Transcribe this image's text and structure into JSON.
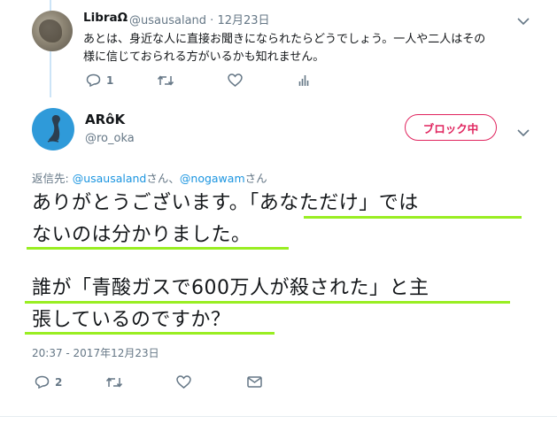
{
  "tweet1": {
    "display_name": "LibraΩ",
    "handle": "@usausaland",
    "separator": "·",
    "date": "12月23日",
    "text_line1": "あとは、身近な人に直接お聞きになられたらどうでしょう。一人や二人はその",
    "text_line2": "様に信じておられる方がいるかも知れません。",
    "reply_count": "1",
    "icons": [
      "reply-icon",
      "retweet-icon",
      "like-icon",
      "analytics-icon",
      "chevron-down-icon"
    ]
  },
  "tweet2": {
    "display_name": "ARôK",
    "handle": "@ro_oka",
    "block_button": "ブロック中",
    "reply_to_prefix": "返信先: ",
    "reply_to_user1": "@usausaland",
    "reply_to_sep": "さん、",
    "reply_to_user2": "@nogawam",
    "reply_to_suffix": "さん",
    "line1": "ありがとうございます。「あなただけ」では",
    "line2": "ないのは分かりました。",
    "line3": "誰が「青酸ガスで600万人が殺された」と主",
    "line4": "張しているのですか？",
    "timestamp": "20:37 - 2017年12月23日",
    "reply_count": "2",
    "icons": [
      "reply-icon",
      "retweet-icon",
      "like-icon",
      "message-icon",
      "chevron-down-icon"
    ]
  },
  "colors": {
    "accent_blue": "#1b95e0",
    "block_red": "#e0245e",
    "muted_gray": "#657786",
    "underline_green": "#99ee22",
    "thread_line": "#cce4f7"
  }
}
